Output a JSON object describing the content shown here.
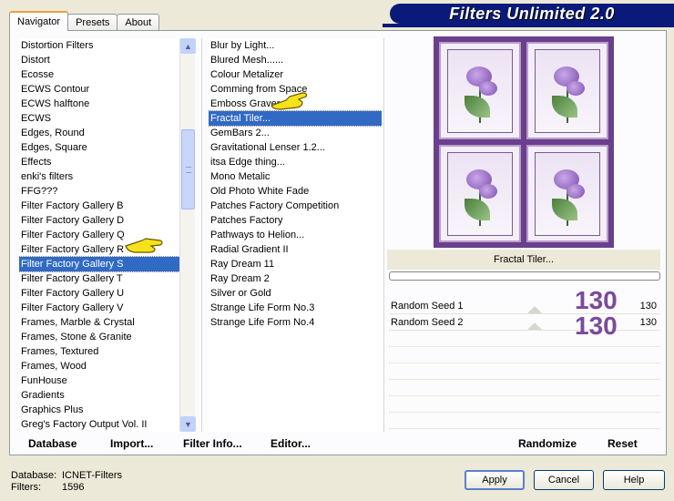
{
  "window": {
    "banner_title": "Filters Unlimited 2.0"
  },
  "tabs": [
    {
      "label": "Navigator",
      "active": true
    },
    {
      "label": "Presets",
      "active": false
    },
    {
      "label": "About",
      "active": false
    }
  ],
  "categories": {
    "items": [
      "Distortion Filters",
      "Distort",
      "Ecosse",
      "ECWS Contour",
      "ECWS halftone",
      "ECWS",
      "Edges, Round",
      "Edges, Square",
      "Effects",
      "enki's filters",
      "FFG???",
      "Filter Factory Gallery B",
      "Filter Factory Gallery D",
      "Filter Factory Gallery Q",
      "Filter Factory Gallery R",
      "Filter Factory Gallery S",
      "Filter Factory Gallery T",
      "Filter Factory Gallery U",
      "Filter Factory Gallery V",
      "Frames, Marble & Crystal",
      "Frames, Stone & Granite",
      "Frames, Textured",
      "Frames, Wood",
      "FunHouse",
      "Gradients",
      "Graphics Plus",
      "Greg's Factory Output Vol. II"
    ],
    "selected_index": 15
  },
  "filters": {
    "items": [
      "Blur by Light...",
      "Blured Mesh......",
      "Colour Metalizer",
      "Comming from Space",
      "Emboss Graver",
      "Fractal Tiler...",
      "GemBars 2...",
      "Gravitational Lenser 1.2...",
      "itsa Edge thing...",
      "Mono Metalic",
      "Old Photo White Fade",
      "Patches Factory Competition",
      "Patches Factory",
      "Pathways to Helion...",
      "Radial Gradient II",
      "Ray Dream 11",
      "Ray Dream 2",
      "Silver or Gold",
      "Strange Life Form No.3",
      "Strange Life Form No.4"
    ],
    "selected_index": 5
  },
  "preview": {
    "caption": "Fractal Tiler..."
  },
  "params": [
    {
      "label": "Random Seed 1",
      "value": "130",
      "big_value": "130"
    },
    {
      "label": "Random Seed 2",
      "value": "130",
      "big_value": "130"
    }
  ],
  "bottom_links": {
    "database": "Database",
    "import": "Import...",
    "filter_info": "Filter Info...",
    "editor": "Editor...",
    "randomize": "Randomize",
    "reset": "Reset"
  },
  "status": {
    "database_label": "Database:",
    "database_value": "ICNET-Filters",
    "filters_label": "Filters:",
    "filters_value": "1596"
  },
  "buttons": {
    "apply": "Apply",
    "cancel": "Cancel",
    "help": "Help"
  }
}
